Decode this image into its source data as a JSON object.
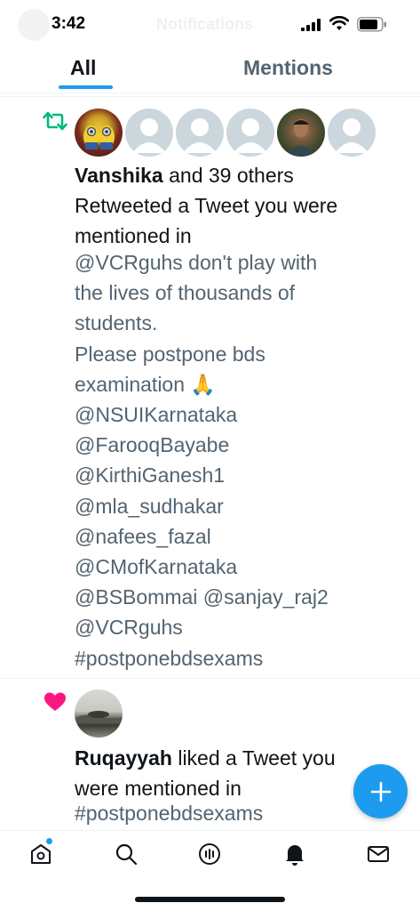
{
  "status_bar": {
    "time": "3:42",
    "ghost_title": "Notifications"
  },
  "tabs": [
    {
      "label": "All",
      "selected": true
    },
    {
      "label": "Mentions",
      "selected": false
    }
  ],
  "notifications": [
    {
      "type": "retweet",
      "icon": "retweet-icon",
      "icon_color": "#00ba7c",
      "actor": "Vanshika",
      "text_line1_rest": " and 39 others",
      "text_line2": "Retweeted a Tweet you were",
      "text_line3": "mentioned in",
      "tweet_lines": [
        "@VCRguhs don't play with",
        "the lives of thousands of",
        "students.",
        "Please postpone bds",
        "examination 🙏",
        "@NSUIKarnataka",
        "@FarooqBayabe",
        "@KirthiGanesh1",
        "@mla_sudhakar",
        "@nafees_fazal",
        "@CMofKarnataka",
        "@BSBommai @sanjay_raj2",
        "@VCRguhs",
        "#postponebdsexams"
      ]
    },
    {
      "type": "like",
      "icon": "heart-icon",
      "icon_color": "#f91880",
      "actor": "Ruqayyah",
      "text_line1_rest": " liked a Tweet you",
      "text_line2": "were mentioned in",
      "tweet_lines": [
        "#postponebdsexams"
      ]
    }
  ],
  "compose_button": {
    "icon": "plus-icon",
    "color": "#1d9bf0"
  },
  "bottom_nav": [
    {
      "name": "home",
      "icon": "home-icon",
      "badge": true
    },
    {
      "name": "search",
      "icon": "search-icon"
    },
    {
      "name": "spaces",
      "icon": "spaces-icon"
    },
    {
      "name": "notifications",
      "icon": "bell-icon",
      "active": true
    },
    {
      "name": "messages",
      "icon": "mail-icon"
    }
  ]
}
